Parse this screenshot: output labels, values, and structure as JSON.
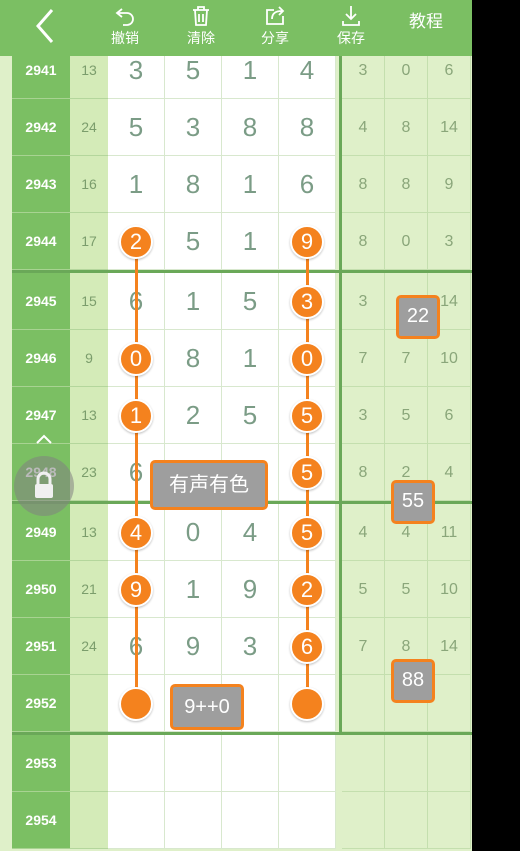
{
  "toolbar": {
    "back_icon": "chevron-left-icon",
    "buttons": [
      {
        "label": "撤销",
        "icon": "undo-icon"
      },
      {
        "label": "清除",
        "icon": "trash-icon"
      },
      {
        "label": "分享",
        "icon": "share-icon"
      },
      {
        "label": "保存",
        "icon": "download-icon"
      }
    ],
    "tutorial_label": "教程"
  },
  "colors": {
    "accent": "#7bbf63",
    "highlight": "#f4821e",
    "tag_bg": "#9e9e9e"
  },
  "rows": [
    {
      "issue": "2941",
      "sum": "13",
      "digits": [
        "3",
        "5",
        "1",
        "4"
      ],
      "spans": [
        "3",
        "0",
        "6"
      ]
    },
    {
      "issue": "2942",
      "sum": "24",
      "digits": [
        "5",
        "3",
        "8",
        "8"
      ],
      "spans": [
        "4",
        "8",
        "14"
      ]
    },
    {
      "issue": "2943",
      "sum": "16",
      "digits": [
        "1",
        "8",
        "1",
        "6"
      ],
      "spans": [
        "8",
        "8",
        "9"
      ]
    },
    {
      "issue": "2944",
      "sum": "17",
      "digits": [
        "2",
        "5",
        "1",
        "9"
      ],
      "spans": [
        "8",
        "0",
        "3"
      ]
    },
    {
      "issue": "2945",
      "sum": "15",
      "digits": [
        "6",
        "1",
        "5",
        "3"
      ],
      "spans": [
        "3",
        "",
        "14"
      ]
    },
    {
      "issue": "2946",
      "sum": "9",
      "digits": [
        "0",
        "8",
        "1",
        "0"
      ],
      "spans": [
        "7",
        "7",
        "10"
      ]
    },
    {
      "issue": "2947",
      "sum": "13",
      "digits": [
        "1",
        "2",
        "5",
        "5"
      ],
      "spans": [
        "3",
        "5",
        "6"
      ]
    },
    {
      "issue": "2948",
      "sum": "23",
      "digits": [
        "6",
        "",
        "",
        "5"
      ],
      "spans": [
        "8",
        "2",
        "4"
      ]
    },
    {
      "issue": "2949",
      "sum": "13",
      "digits": [
        "4",
        "0",
        "4",
        "5"
      ],
      "spans": [
        "4",
        "4",
        "11"
      ]
    },
    {
      "issue": "2950",
      "sum": "21",
      "digits": [
        "9",
        "1",
        "9",
        "2"
      ],
      "spans": [
        "5",
        "5",
        "10"
      ]
    },
    {
      "issue": "2951",
      "sum": "24",
      "digits": [
        "6",
        "9",
        "3",
        "6"
      ],
      "spans": [
        "7",
        "8",
        "14"
      ]
    },
    {
      "issue": "2952",
      "sum": "",
      "digits": [
        "",
        "",
        "",
        ""
      ],
      "spans": [
        "",
        "",
        ""
      ]
    },
    {
      "issue": "2953",
      "sum": "",
      "digits": [
        "",
        "",
        "",
        ""
      ],
      "spans": [
        "",
        "",
        ""
      ]
    },
    {
      "issue": "2954",
      "sum": "",
      "digits": [
        "",
        "",
        "",
        ""
      ],
      "spans": [
        "",
        "",
        ""
      ]
    }
  ],
  "circles_col1": [
    "2",
    "0",
    "1",
    "4",
    "9",
    ""
  ],
  "circles_col4": [
    "9",
    "3",
    "0",
    "5",
    "5",
    "5",
    "2",
    "6",
    ""
  ],
  "tags": {
    "t22": "22",
    "t55": "55",
    "t88": "88",
    "sound_color": "有声有色",
    "combo": "9++0"
  },
  "lock_icon": "lock-icon"
}
